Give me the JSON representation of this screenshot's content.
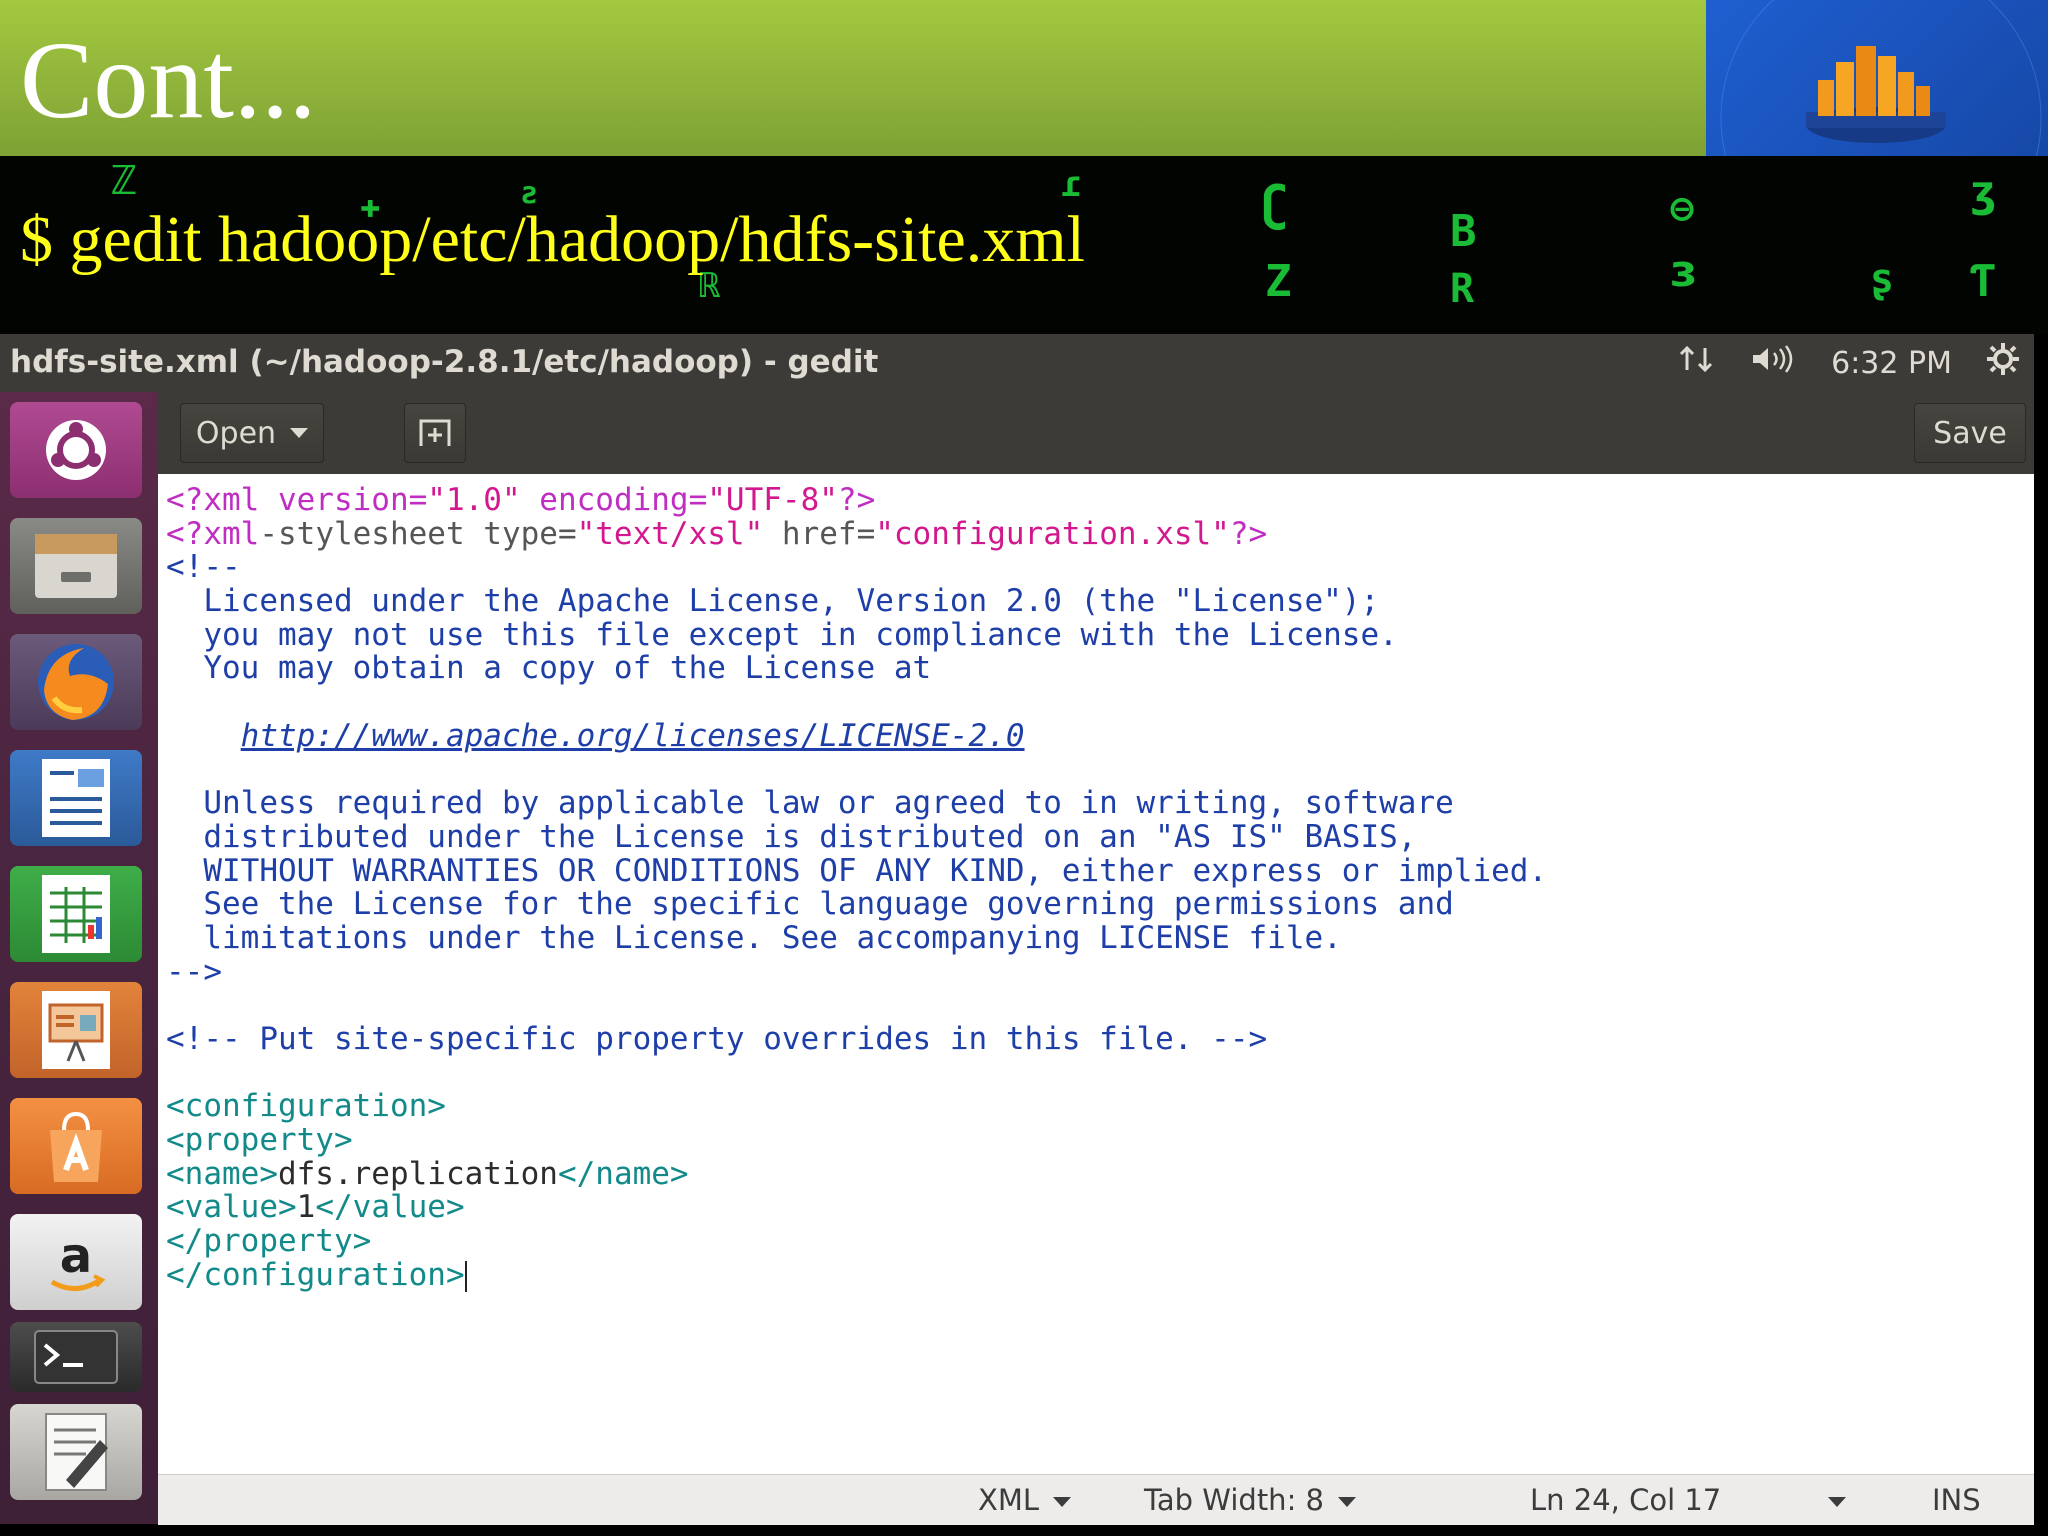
{
  "slide": {
    "title": "Cont...",
    "command": "$ gedit hadoop/etc/hadoop/hdfs-site.xml",
    "colors": {
      "header": "#8fb33a",
      "command": "#ffff1a",
      "logo_bg": "#1a51b8"
    }
  },
  "window": {
    "title": "hdfs-site.xml (~/hadoop-2.8.1/etc/hadoop) - gedit",
    "clock": "6:32 PM",
    "indicators": [
      "network-icon",
      "volume-icon",
      "settings-gear-icon"
    ]
  },
  "launcher": {
    "items": [
      {
        "name": "ubuntu-dash-icon"
      },
      {
        "name": "files-icon"
      },
      {
        "name": "firefox-icon"
      },
      {
        "name": "writer-icon"
      },
      {
        "name": "calc-icon"
      },
      {
        "name": "impress-icon"
      },
      {
        "name": "software-center-icon"
      },
      {
        "name": "amazon-icon"
      },
      {
        "name": "terminal-icon"
      },
      {
        "name": "text-editor-icon"
      }
    ]
  },
  "toolbar": {
    "open_label": "Open",
    "save_label": "Save",
    "new_tab_icon": "new-document-icon"
  },
  "editor": {
    "lines": {
      "l1": {
        "a": "<?xml version=",
        "b": "\"1.0\"",
        "c": " encoding=",
        "d": "\"UTF-8\"",
        "e": "?>"
      },
      "l2": {
        "a": "<?xml",
        "b": "-stylesheet type=",
        "c": "\"text/xsl\"",
        "d": " href=",
        "e": "\"configuration.xsl\"",
        "f": "?>"
      },
      "l3": "<!--",
      "l4": "  Licensed under the Apache License, Version 2.0 (the \"License\");",
      "l5": "  you may not use this file except in compliance with the License.",
      "l6": "  You may obtain a copy of the License at",
      "l7": "",
      "l8_indent": "    ",
      "l8_url": "http://www.apache.org/licenses/LICENSE-2.0",
      "l9": "",
      "l10": "  Unless required by applicable law or agreed to in writing, software",
      "l11": "  distributed under the License is distributed on an \"AS IS\" BASIS,",
      "l12": "  WITHOUT WARRANTIES OR CONDITIONS OF ANY KIND, either express or implied.",
      "l13": "  See the License for the specific language governing permissions and",
      "l14": "  limitations under the License. See accompanying LICENSE file.",
      "l15": "-->",
      "l16": "",
      "l17": "<!-- Put site-specific property overrides in this file. -->",
      "l18": "",
      "l19": "<configuration>",
      "l20": "<property>",
      "l21": {
        "open": "<name>",
        "value": "dfs.replication",
        "close": "</name>"
      },
      "l22": {
        "open": "<value>",
        "value": "1",
        "close": "</value>"
      },
      "l23": "</property>",
      "l24": "</configuration>"
    }
  },
  "statusbar": {
    "language": "XML",
    "tab_width": "Tab Width: 8",
    "position": "Ln 24, Col 17",
    "mode": "INS"
  }
}
